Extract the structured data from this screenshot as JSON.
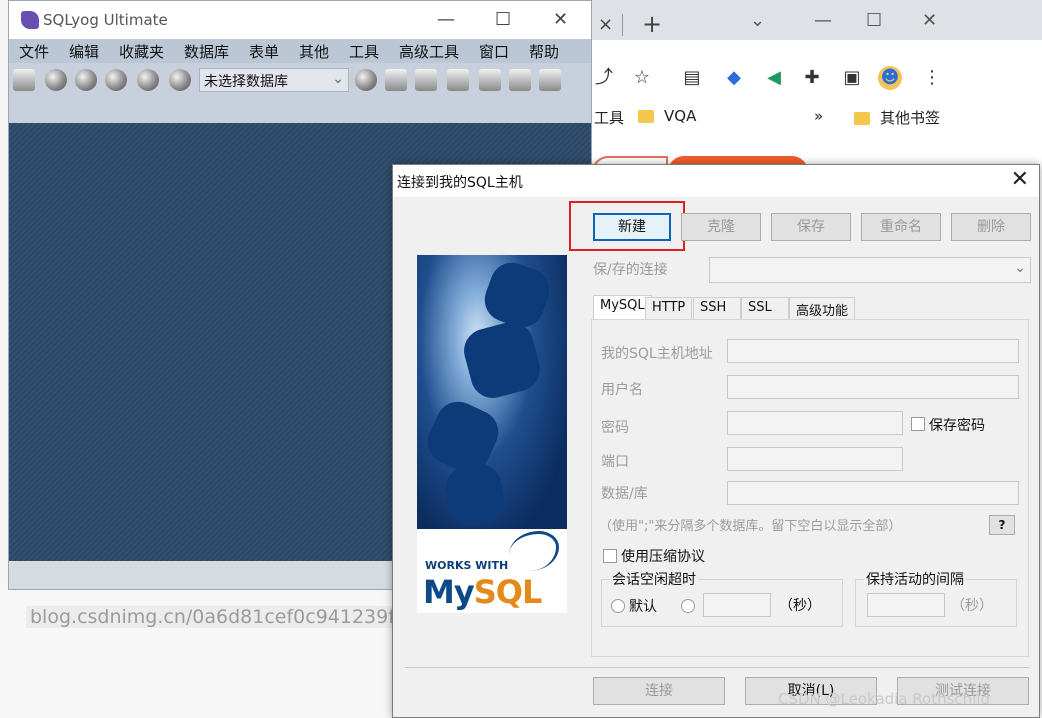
{
  "browser": {
    "tab_close": "×",
    "new_tab": "+",
    "bookmarks": [
      {
        "label": "工具"
      },
      {
        "label": "VQA"
      },
      {
        "label": "»"
      },
      {
        "label": "其他书签"
      }
    ],
    "blog_text": "blog.csdnimg.cn/0a6d81cef0c941239f"
  },
  "sqlyog": {
    "title": "SQLyog Ultimate",
    "menu": [
      "文件",
      "编辑",
      "收藏夹",
      "数据库",
      "表单",
      "其他",
      "工具",
      "高级工具",
      "窗口",
      "帮助"
    ],
    "db_select": "未选择数据库"
  },
  "dialog": {
    "title": "连接到我的SQL主机",
    "buttons": {
      "new": "新建",
      "clone": "克隆",
      "save": "保存",
      "rename": "重命名",
      "delete": "删除"
    },
    "saved_conn_label": "保/存的连接",
    "tabs": [
      "MySQL",
      "HTTP",
      "SSH",
      "SSL",
      "高级功能"
    ],
    "fields": {
      "host": "我的SQL主机地址",
      "user": "用户名",
      "password": "密码",
      "port": "端口",
      "database": "数据/库"
    },
    "save_password": "保存密码",
    "db_hint": "（使用\";\"来分隔多个数据库。留下空白以显示全部）",
    "help": "?",
    "compress": "使用压缩协议",
    "session_timeout": {
      "title": "会话空闲超时",
      "default": "默认",
      "unit": "（秒）"
    },
    "keepalive": {
      "title": "保持活动的间隔",
      "unit": "（秒）"
    },
    "footer": {
      "connect": "连接",
      "cancel": "取消(L)",
      "test": "测试连接"
    },
    "logo": {
      "works_with": "WORKS WITH",
      "brand_my": "My",
      "brand_sql": "SQL"
    }
  },
  "watermark": "CSDN @Leokadia Rothschild"
}
